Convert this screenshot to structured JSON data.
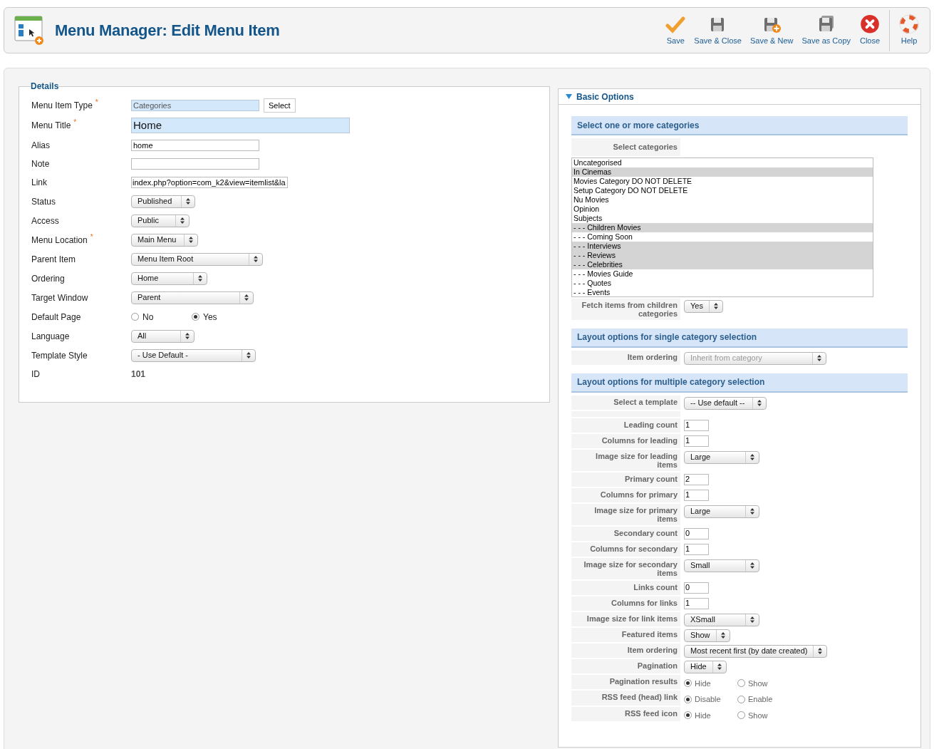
{
  "header": {
    "title": "Menu Manager: Edit Menu Item"
  },
  "toolbar": [
    {
      "kind": "save",
      "label": "Save"
    },
    {
      "kind": "save_close",
      "label": "Save & Close"
    },
    {
      "kind": "save_new",
      "label": "Save & New"
    },
    {
      "kind": "save_copy",
      "label": "Save as Copy"
    },
    {
      "kind": "close",
      "label": "Close"
    },
    {
      "kind": "help",
      "label": "Help"
    }
  ],
  "details": {
    "legend": "Details",
    "fields": [
      {
        "label": "Menu Item Type",
        "required_mark": "*",
        "kind": "type",
        "value": "Categories",
        "button": "Select"
      },
      {
        "label": "Menu Title",
        "required_mark": "*",
        "kind": "title",
        "value": "Home"
      },
      {
        "label": "Alias",
        "kind": "text",
        "value": "home"
      },
      {
        "label": "Note",
        "kind": "text"
      },
      {
        "label": "Link",
        "kind": "link",
        "value": "index.php?option=com_k2&view=itemlist&la"
      },
      {
        "label": "Status",
        "kind": "select",
        "value": "Published"
      },
      {
        "label": "Access",
        "kind": "select",
        "value": "Public"
      },
      {
        "label": "Menu Location",
        "required_mark": "*",
        "kind": "select",
        "value": "Main Menu"
      },
      {
        "label": "Parent Item",
        "kind": "select",
        "value": "Menu Item Root"
      },
      {
        "label": "Ordering",
        "kind": "select",
        "value": "Home"
      },
      {
        "label": "Target Window",
        "kind": "select",
        "value": "Parent"
      },
      {
        "label": "Default Page",
        "kind": "radio",
        "options": [
          {
            "label": "No",
            "selected": false
          },
          {
            "label": "Yes",
            "selected": true
          }
        ]
      },
      {
        "label": "Language",
        "kind": "select",
        "value": "All"
      },
      {
        "label": "Template Style",
        "kind": "select",
        "value": "- Use Default -"
      },
      {
        "label": "ID",
        "kind": "static",
        "value": "101"
      }
    ]
  },
  "basic_options": {
    "title": "Basic Options",
    "expanded": true,
    "sections": [
      {
        "heading": "Select one or more categories",
        "rows": [
          {
            "kind": "list",
            "label": "Select categories",
            "items": [
              {
                "label": "Uncategorised",
                "selected": false
              },
              {
                "label": "In Cinemas",
                "selected": true
              },
              {
                "label": "Movies Category DO NOT DELETE",
                "selected": false
              },
              {
                "label": "Setup Category DO NOT DELETE",
                "selected": false
              },
              {
                "label": "Nu Movies",
                "selected": false
              },
              {
                "label": "Opinion",
                "selected": false
              },
              {
                "label": "Subjects",
                "selected": false
              },
              {
                "label": "- - - Children Movies",
                "selected": true
              },
              {
                "label": "- - - Coming Soon",
                "selected": false
              },
              {
                "label": "- - - Interviews",
                "selected": true
              },
              {
                "label": "- - - Reviews",
                "selected": true
              },
              {
                "label": "- - - Celebrities",
                "selected": true
              },
              {
                "label": "- - - Movies Guide",
                "selected": false
              },
              {
                "label": "- - - Quotes",
                "selected": false
              },
              {
                "label": "- - - Events",
                "selected": false
              }
            ]
          },
          {
            "kind": "select",
            "label": "Fetch items from children categories",
            "value": "Yes",
            "disabled": false
          }
        ]
      },
      {
        "heading": "Layout options for single category selection",
        "rows": [
          {
            "kind": "select",
            "label": "Item ordering",
            "value": "Inherit from category",
            "disabled": true
          }
        ]
      },
      {
        "heading": "Layout options for multiple category selection",
        "rows": [
          {
            "kind": "select",
            "label": "Select a template",
            "value": "-- Use default --",
            "disabled": false
          },
          {
            "kind": "spacer"
          },
          {
            "kind": "text",
            "label": "Leading count",
            "value": "1"
          },
          {
            "kind": "text",
            "label": "Columns for leading",
            "value": "1"
          },
          {
            "kind": "select",
            "label": "Image size for leading items",
            "value": "Large",
            "disabled": false
          },
          {
            "kind": "text",
            "label": "Primary count",
            "value": "2"
          },
          {
            "kind": "text",
            "label": "Columns for primary",
            "value": "1"
          },
          {
            "kind": "select",
            "label": "Image size for primary items",
            "value": "Large",
            "disabled": false
          },
          {
            "kind": "text",
            "label": "Secondary count",
            "value": "0"
          },
          {
            "kind": "text",
            "label": "Columns for secondary",
            "value": "1"
          },
          {
            "kind": "select",
            "label": "Image size for secondary items",
            "value": "Small",
            "disabled": false
          },
          {
            "kind": "text",
            "label": "Links count",
            "value": "0"
          },
          {
            "kind": "text",
            "label": "Columns for links",
            "value": "1"
          },
          {
            "kind": "select",
            "label": "Image size for link items",
            "value": "XSmall",
            "disabled": false
          },
          {
            "kind": "select",
            "label": "Featured items",
            "value": "Show",
            "disabled": false
          },
          {
            "kind": "select",
            "label": "Item ordering",
            "value": "Most recent first (by date created)",
            "disabled": false
          },
          {
            "kind": "select",
            "label": "Pagination",
            "value": "Hide",
            "disabled": false
          },
          {
            "kind": "radio",
            "label": "Pagination results",
            "options": [
              {
                "label": "Hide",
                "selected": true
              },
              {
                "label": "Show",
                "selected": false
              }
            ]
          },
          {
            "kind": "radio",
            "label": "RSS feed (head) link",
            "options": [
              {
                "label": "Disable",
                "selected": true
              },
              {
                "label": "Enable",
                "selected": false
              }
            ]
          },
          {
            "kind": "radio",
            "label": "RSS feed icon",
            "options": [
              {
                "label": "Hide",
                "selected": true
              },
              {
                "label": "Show",
                "selected": false
              }
            ]
          }
        ]
      }
    ]
  }
}
